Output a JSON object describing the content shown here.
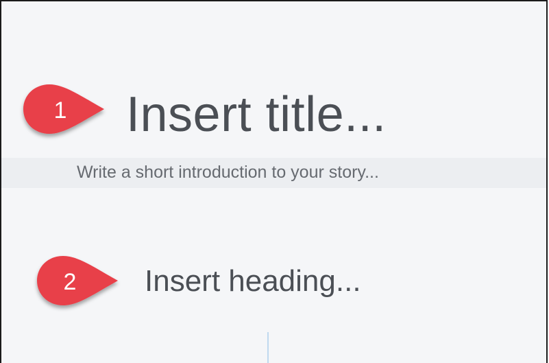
{
  "editor": {
    "title_placeholder": "Insert title...",
    "intro_placeholder": "Write a short introduction to your story...",
    "heading_placeholder": "Insert heading..."
  },
  "annotations": {
    "marker_1": "1",
    "marker_2": "2",
    "marker_color": "#e8404a"
  },
  "colors": {
    "canvas": "#f5f6f8",
    "intro_band": "#eceef1",
    "text_primary": "#4b4f55",
    "text_secondary": "#666a70"
  }
}
